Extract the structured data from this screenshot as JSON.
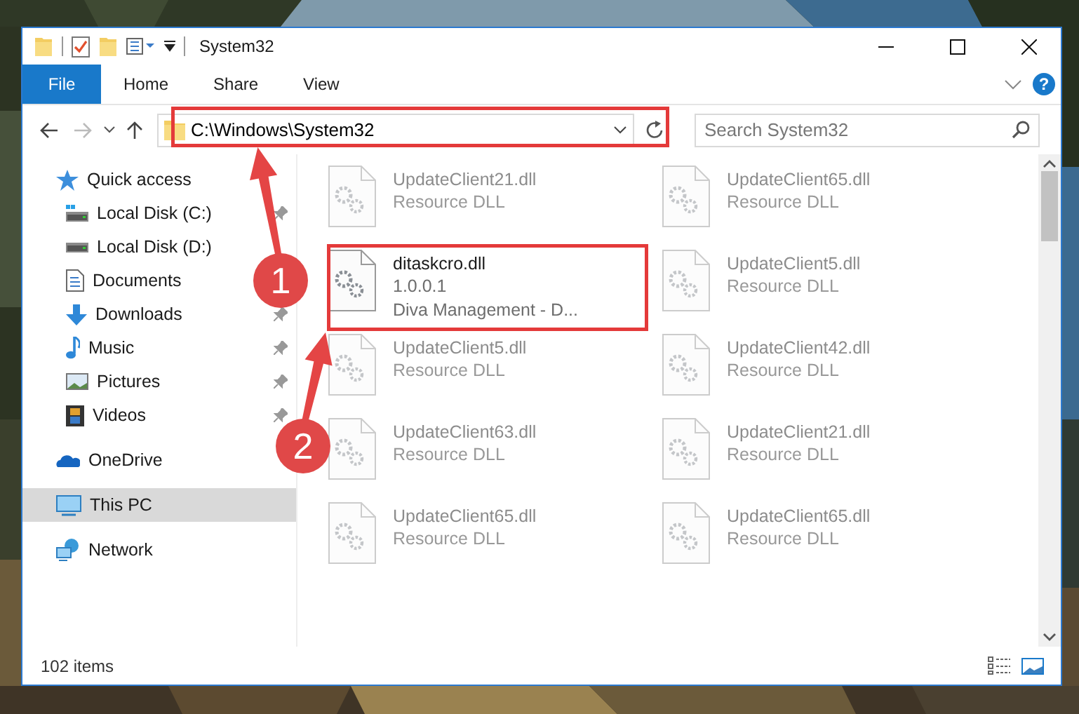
{
  "window": {
    "title": "System32"
  },
  "ribbon": {
    "tabs": [
      {
        "label": "File",
        "kind": "file"
      },
      {
        "label": "Home",
        "kind": "tab"
      },
      {
        "label": "Share",
        "kind": "tab"
      },
      {
        "label": "View",
        "kind": "tab"
      }
    ],
    "help_label": "?"
  },
  "address": {
    "path": "C:\\Windows\\System32"
  },
  "search": {
    "placeholder": "Search System32"
  },
  "sidebar": {
    "items": [
      {
        "label": "Quick access",
        "kind": "star",
        "selected": false,
        "children": [
          {
            "label": "Local Disk (C:)",
            "kind": "drive-c",
            "pinned": true,
            "selected": false
          },
          {
            "label": "Local Disk (D:)",
            "kind": "drive",
            "pinned": false,
            "selected": false
          },
          {
            "label": "Documents",
            "kind": "documents",
            "pinned": false,
            "selected": false
          },
          {
            "label": "Downloads",
            "kind": "downloads",
            "pinned": true,
            "selected": false
          },
          {
            "label": "Music",
            "kind": "music",
            "pinned": true,
            "selected": false
          },
          {
            "label": "Pictures",
            "kind": "pictures",
            "pinned": true,
            "selected": false
          },
          {
            "label": "Videos",
            "kind": "videos",
            "pinned": true,
            "selected": false
          }
        ]
      },
      {
        "label": "OneDrive",
        "kind": "onedrive",
        "selected": false
      },
      {
        "label": "This PC",
        "kind": "pc",
        "selected": true
      },
      {
        "label": "Network",
        "kind": "network",
        "selected": false
      }
    ]
  },
  "files": [
    {
      "name": "UpdateClient21.dll",
      "lines": [
        "Resource DLL"
      ],
      "blurred": true
    },
    {
      "name": "UpdateClient65.dll",
      "lines": [
        "Resource DLL"
      ],
      "blurred": true
    },
    {
      "name": "ditaskcro.dll",
      "lines": [
        "1.0.0.1",
        "Diva Management - D..."
      ],
      "blurred": false
    },
    {
      "name": "UpdateClient5.dll",
      "lines": [
        "Resource DLL"
      ],
      "blurred": true
    },
    {
      "name": "UpdateClient5.dll",
      "lines": [
        "Resource DLL"
      ],
      "blurred": true
    },
    {
      "name": "UpdateClient42.dll",
      "lines": [
        "Resource DLL"
      ],
      "blurred": true
    },
    {
      "name": "UpdateClient63.dll",
      "lines": [
        "Resource DLL"
      ],
      "blurred": true
    },
    {
      "name": "UpdateClient21.dll",
      "lines": [
        "Resource DLL"
      ],
      "blurred": true
    },
    {
      "name": "UpdateClient65.dll",
      "lines": [
        "Resource DLL"
      ],
      "blurred": true
    },
    {
      "name": "UpdateClient65.dll",
      "lines": [
        "Resource DLL"
      ],
      "blurred": true
    }
  ],
  "status_bar": {
    "count": "102 items"
  },
  "steps": [
    {
      "label": "1"
    },
    {
      "label": "2"
    }
  ]
}
